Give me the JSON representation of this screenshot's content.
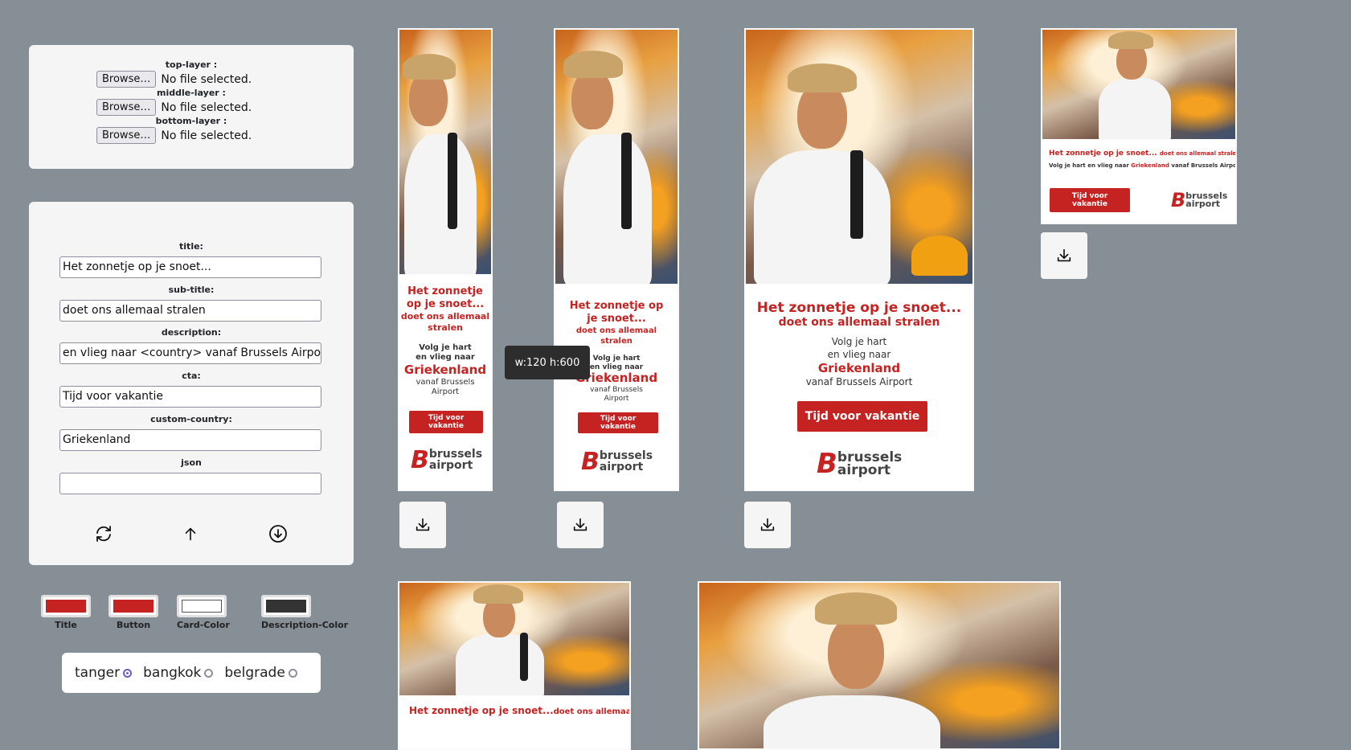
{
  "upload": {
    "layers": [
      {
        "label": "top-layer :",
        "button": "Browse…",
        "status": "No file selected."
      },
      {
        "label": "middle-layer :",
        "button": "Browse…",
        "status": "No file selected."
      },
      {
        "label": "bottom-layer :",
        "button": "Browse…",
        "status": "No file selected."
      }
    ]
  },
  "form": {
    "title_label": "title:",
    "title_value": "Het zonnetje op je snoet...",
    "subtitle_label": "sub-title:",
    "subtitle_value": "doet ons allemaal stralen",
    "description_label": "description:",
    "description_value": "en vlieg naar <country> vanaf Brussels Airport",
    "cta_label": "cta:",
    "cta_value": "Tijd voor vakantie",
    "country_label": "custom-country:",
    "country_value": "Griekenland",
    "json_label": "json",
    "json_value": "",
    "actions": [
      "refresh-icon",
      "upload-arrow-icon",
      "download-circle-icon"
    ]
  },
  "colors": {
    "title": {
      "label": "Title",
      "value": "#c52322"
    },
    "button": {
      "label": "Button",
      "value": "#c52322"
    },
    "card": {
      "label": "Card-Color",
      "value": "#ffffff"
    },
    "description": {
      "label": "Description-Color",
      "value": "#333333"
    }
  },
  "themes": {
    "options": [
      "tanger",
      "bangkok",
      "belgrade"
    ],
    "selected": "tanger"
  },
  "banner": {
    "title": "Het zonnetje op je snoet...",
    "subtitle": "doet ons allemaal stralen",
    "desc_line1": "Volg je hart",
    "desc_line2": "en vlieg naar",
    "desc_inline": "Volg je hart en vlieg naar",
    "country": "Griekenland",
    "from": "vanaf Brussels Airport",
    "from_line1": "vanaf Brussels",
    "from_line2": "Airport",
    "cta": "Tijd voor vakantie",
    "cta_line1": "Tijd voor",
    "cta_line2": "vakantie",
    "logo_top": "brussels",
    "logo_bottom": "airport",
    "title_l1": "Het zonnetje",
    "title_l2": "op je snoet...",
    "title_m1": "Het zonnetje op",
    "title_m2": "je snoet...",
    "sub_l1": "doet ons allemaal",
    "sub_l2": "stralen"
  },
  "tooltip": "w:120 h:600",
  "icons": {
    "download": "download-icon"
  }
}
